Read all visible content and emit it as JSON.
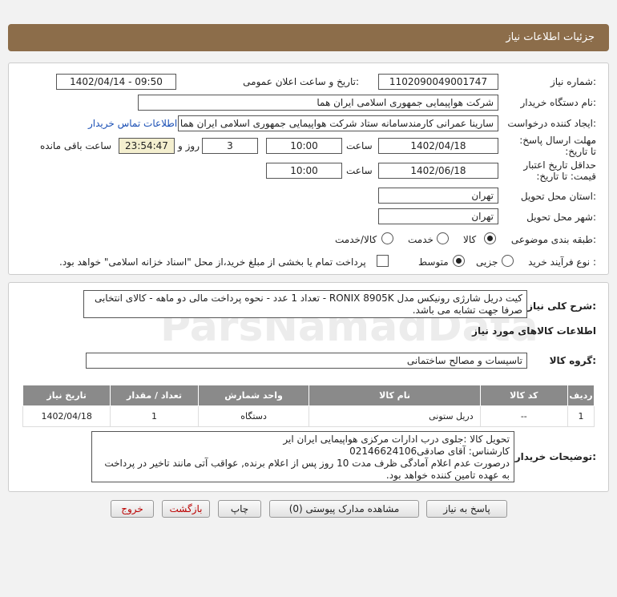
{
  "header": {
    "title": "جزئیات اطلاعات نیاز"
  },
  "form": {
    "need_number_label": "شماره نیاز:",
    "need_number": "1102090049001747",
    "announce_label": "تاریخ و ساعت اعلان عمومی:",
    "announce_value": "1402/04/14 - 09:50",
    "buyer_org_label": "نام دستگاه خریدار:",
    "buyer_org": "شرکت هواپیمایی جمهوری اسلامی ایران هما",
    "requester_label": "ایجاد کننده درخواست:",
    "requester": "سارینا عمرانی کارمندسامانه ستاد شرکت هواپیمایی جمهوری اسلامی ایران هما",
    "contact_link": "اطلاعات تماس خریدار",
    "deadline_label": "مهلت ارسال پاسخ: تا تاریخ:",
    "deadline_date": "1402/04/18",
    "time_label": "ساعت",
    "deadline_time": "10:00",
    "days_value": "3",
    "days_label": "روز و",
    "remaining_time": "23:54:47",
    "remaining_label": "ساعت باقی مانده",
    "validity_label": "حداقل تاریخ اعتبار قیمت: تا تاریخ:",
    "validity_date": "1402/06/18",
    "validity_time_label": "ساعت",
    "validity_time": "10:00",
    "province_label": "استان محل تحویل:",
    "province": "تهران",
    "city_label": "شهر محل تحویل:",
    "city": "تهران",
    "category_label": "طبقه بندی موضوعی:",
    "category_options": [
      "کالا",
      "خدمت",
      "کالا/خدمت"
    ],
    "category_selected": "کالا",
    "process_label": "نوع فرآیند خرید :",
    "process_options": [
      "جزیی",
      "متوسط"
    ],
    "process_selected": "متوسط",
    "payment_note": "پرداخت تمام یا بخشی از مبلغ خرید،از محل \"اسناد خزانه اسلامی\" خواهد بود."
  },
  "details": {
    "summary_label": "شرح کلی نیاز:",
    "summary_text": "کیت دریل شارژی رونیکس مدل RONIX 8905K - تعداد 1 عدد - نحوه پرداخت مالی دو ماهه - کالای انتخابی صرفا جهت تشابه می باشد.",
    "goods_info_heading": "اطلاعات کالاهای مورد نیاز",
    "goods_group_label": "گروه کالا:",
    "goods_group": "تاسیسات و مصالح ساختمانی",
    "table_headers": [
      "ردیف",
      "کد کالا",
      "نام کالا",
      "واحد شمارش",
      "تعداد / مقدار",
      "تاریخ نیاز"
    ],
    "table_rows": [
      [
        "1",
        "--",
        "دریل ستونی",
        "دستگاه",
        "1",
        "1402/04/18"
      ]
    ],
    "buyer_notes_label": "توضیحات خریدار:",
    "buyer_notes": [
      "تحویل کالا :جلوی درب ادارات مرکزی هواپیمایی ایران ایر",
      "کارشناس: آقای صادقی02146624106",
      "درصورت عدم اعلام آمادگی ظرف مدت 10 روز پس از اعلام برنده, عواقب آتی مانند تاخیر در پرداخت به عهده تامین کننده خواهد بود."
    ]
  },
  "buttons": {
    "reply": "پاسخ به نیاز",
    "attachments": "مشاهده مدارک پیوستی (0)",
    "print": "چاپ",
    "back": "بازگشت",
    "exit": "خروج"
  },
  "watermark": {
    "brand": "ParsNamadData"
  }
}
